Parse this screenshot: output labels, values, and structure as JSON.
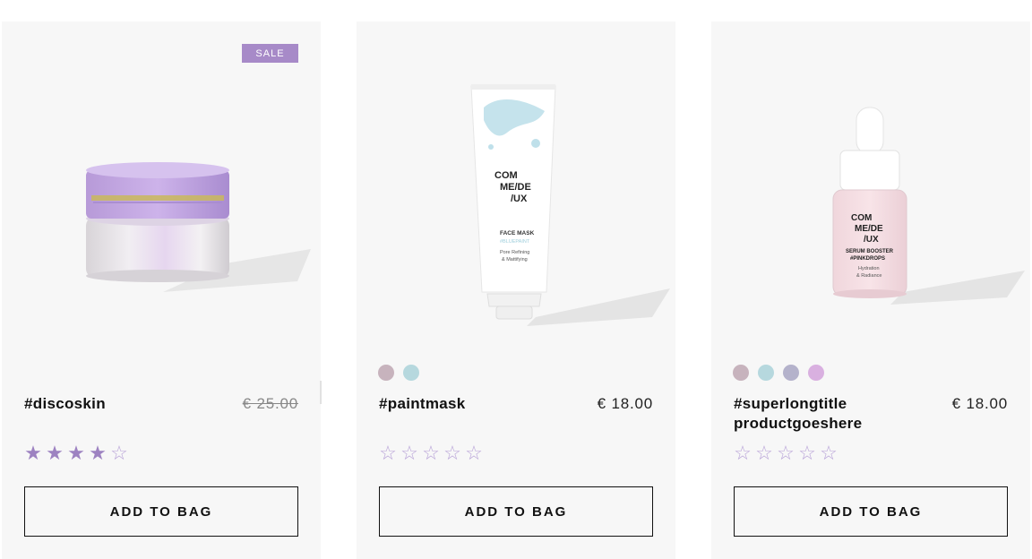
{
  "products": [
    {
      "badge": "SALE",
      "name": "#discoskin",
      "price": "€ 25.00",
      "price_struck": true,
      "swatches": [],
      "rating": 4,
      "max_rating": 5,
      "cta": "ADD TO BAG"
    },
    {
      "name": "#paintmask",
      "price": "€ 18.00",
      "price_struck": false,
      "swatches": [
        "#c7b3bd",
        "#b6d8de"
      ],
      "rating": 0,
      "max_rating": 5,
      "cta": "ADD TO BAG",
      "package_text": {
        "brand_lines": [
          "COM",
          "ME/DE",
          "/UX"
        ],
        "product": "FACE MASK",
        "subtitle": "#BLUEPAINT",
        "desc_lines": [
          "Pore Refining",
          "& Mattifying"
        ]
      }
    },
    {
      "name": "#superlongtitle productgoeshere",
      "price": "€ 18.00",
      "price_struck": false,
      "swatches": [
        "#c7b3bd",
        "#b6d8de",
        "#b4b2cb",
        "#d9b0e0"
      ],
      "rating": 0,
      "max_rating": 5,
      "cta": "ADD TO BAG",
      "package_text": {
        "brand_lines": [
          "COM",
          "ME/DE",
          "/UX"
        ],
        "product": "SERUM BOOSTER",
        "subtitle": "#PINKDROPS",
        "desc_lines": [
          "Hydration",
          "& Radiance"
        ]
      }
    }
  ],
  "colors": {
    "accent": "#a78ac8",
    "star": "#9d82c1",
    "card_bg": "#f7f7f7"
  }
}
